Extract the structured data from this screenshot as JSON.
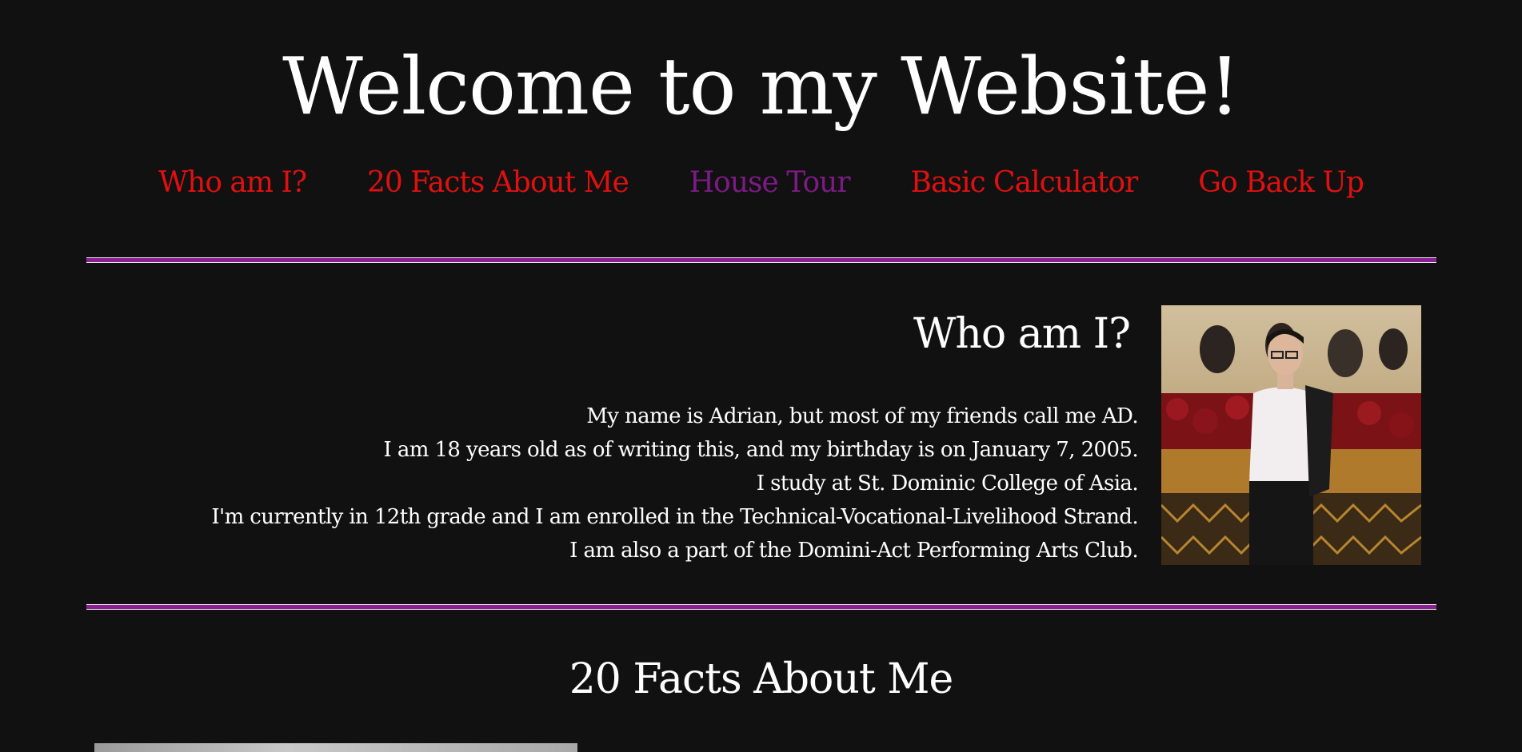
{
  "header": {
    "title": "Welcome to my Website!"
  },
  "nav": {
    "items": [
      {
        "label": "Who am I?"
      },
      {
        "label": "20 Facts About Me"
      },
      {
        "label": "House Tour"
      },
      {
        "label": "Basic Calculator"
      },
      {
        "label": "Go Back Up"
      }
    ]
  },
  "who": {
    "heading": "Who am I?",
    "lines": [
      "My name is Adrian, but most of my friends call me AD.",
      "I am 18 years old as of writing this, and my birthday is on January 7, 2005.",
      "I study at St. Dominic College of Asia.",
      "I'm currently in 12th grade and I am enrolled in the Technical-Vocational-Livelihood Strand.",
      "I am also a part of the Domini-Act Performing Arts Club."
    ]
  },
  "facts": {
    "heading": "20 Facts About Me"
  },
  "colors": {
    "background": "#111111",
    "link": "#e01010",
    "visited_link": "#7d1a86",
    "divider": "#8b1f93",
    "text": "#ffffff"
  }
}
